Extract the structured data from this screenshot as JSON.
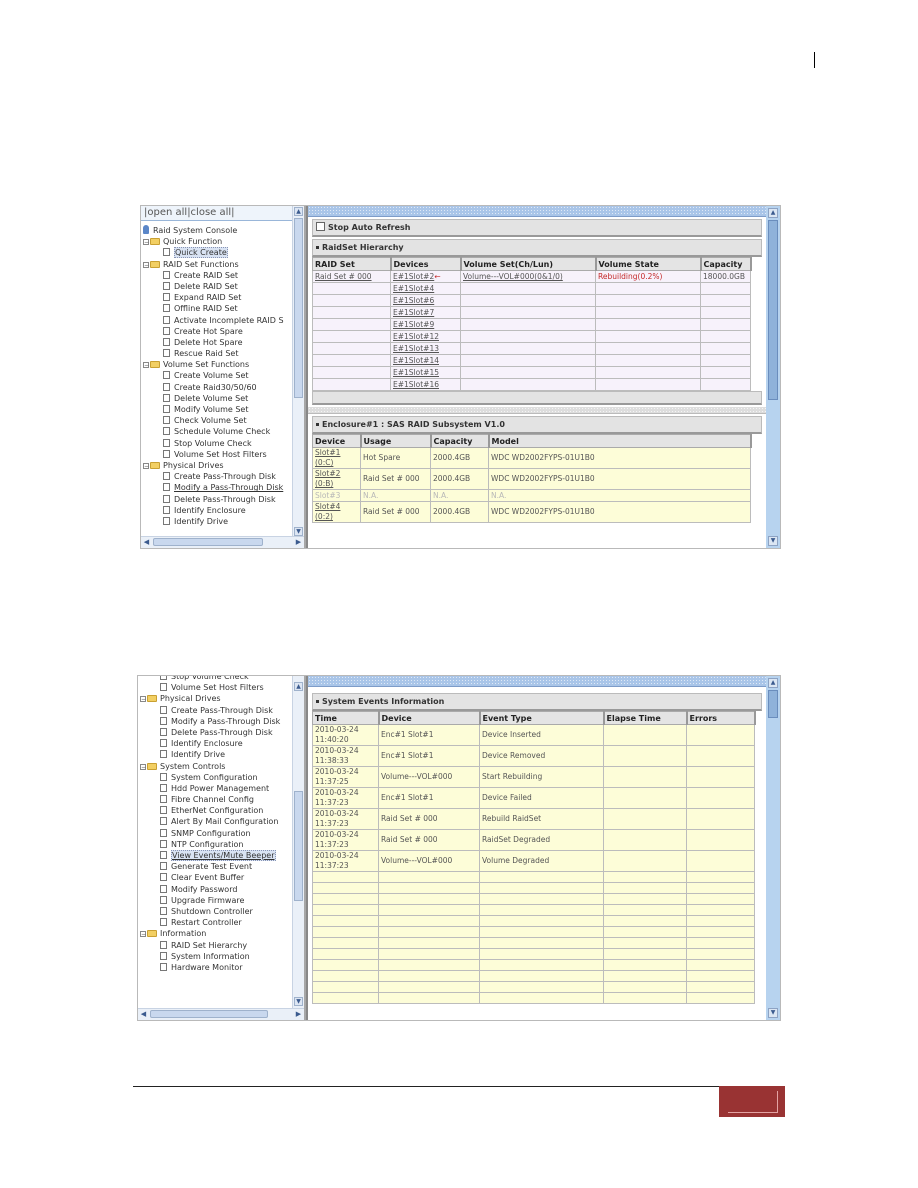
{
  "page": {
    "number": ""
  },
  "screenshot1": {
    "tree": {
      "header": "|open all|close all|",
      "items": [
        {
          "label": "Raid System Console",
          "level": 0,
          "type": "console"
        },
        {
          "label": "Quick Function",
          "level": 1,
          "type": "folder"
        },
        {
          "label": "Quick Create",
          "level": 2,
          "type": "page",
          "selected": true
        },
        {
          "label": "RAID Set Functions",
          "level": 1,
          "type": "folder"
        },
        {
          "label": "Create RAID Set",
          "level": 2,
          "type": "page"
        },
        {
          "label": "Delete RAID Set",
          "level": 2,
          "type": "page"
        },
        {
          "label": "Expand RAID Set",
          "level": 2,
          "type": "page"
        },
        {
          "label": "Offline RAID Set",
          "level": 2,
          "type": "page"
        },
        {
          "label": "Activate Incomplete RAID S",
          "level": 2,
          "type": "page"
        },
        {
          "label": "Create Hot Spare",
          "level": 2,
          "type": "page"
        },
        {
          "label": "Delete Hot Spare",
          "level": 2,
          "type": "page"
        },
        {
          "label": "Rescue Raid Set",
          "level": 2,
          "type": "page"
        },
        {
          "label": "Volume Set Functions",
          "level": 1,
          "type": "folder"
        },
        {
          "label": "Create Volume Set",
          "level": 2,
          "type": "page"
        },
        {
          "label": "Create Raid30/50/60",
          "level": 2,
          "type": "page"
        },
        {
          "label": "Delete Volume Set",
          "level": 2,
          "type": "page"
        },
        {
          "label": "Modify Volume Set",
          "level": 2,
          "type": "page"
        },
        {
          "label": "Check Volume Set",
          "level": 2,
          "type": "page"
        },
        {
          "label": "Schedule Volume Check",
          "level": 2,
          "type": "page"
        },
        {
          "label": "Stop Volume Check",
          "level": 2,
          "type": "page"
        },
        {
          "label": "Volume Set Host Filters",
          "level": 2,
          "type": "page"
        },
        {
          "label": "Physical Drives",
          "level": 1,
          "type": "folder"
        },
        {
          "label": "Create Pass-Through Disk",
          "level": 2,
          "type": "page"
        },
        {
          "label": "Modify a Pass-Through Disk",
          "level": 2,
          "type": "page",
          "hover": true
        },
        {
          "label": "Delete Pass-Through Disk",
          "level": 2,
          "type": "page"
        },
        {
          "label": "Identify Enclosure",
          "level": 2,
          "type": "page"
        },
        {
          "label": "Identify Drive",
          "level": 2,
          "type": "page"
        }
      ]
    },
    "stop_auto_refresh": "Stop Auto Refresh",
    "raidset_section": "RaidSet Hierarchy",
    "raidset_table": {
      "headers": [
        "RAID Set",
        "Devices",
        "Volume Set(Ch/Lun)",
        "Volume State",
        "Capacity"
      ],
      "raid_set": "Raid Set # 000",
      "devices": [
        "E#1Slot#2",
        "E#1Slot#4",
        "E#1Slot#6",
        "E#1Slot#7",
        "E#1Slot#9",
        "E#1Slot#12",
        "E#1Slot#13",
        "E#1Slot#14",
        "E#1Slot#15",
        "E#1Slot#16"
      ],
      "device_marker": "←",
      "volume_set": "Volume---VOL#000(0&1/0)",
      "volume_state": "Rebuilding(0.2%)",
      "capacity": "18000.0GB"
    },
    "enclosure_section": "Enclosure#1 : SAS RAID Subsystem V1.0",
    "enclosure_table": {
      "headers": [
        "Device",
        "Usage",
        "Capacity",
        "Model"
      ],
      "rows": [
        {
          "device": "Slot#1",
          "sub": "(0:C)",
          "usage": "Hot Spare",
          "capacity": "2000.4GB",
          "model": "WDC WD2002FYPS-01U1B0",
          "dim": false
        },
        {
          "device": "Slot#2",
          "sub": "(0:B)",
          "usage": "Raid Set # 000",
          "capacity": "2000.4GB",
          "model": "WDC WD2002FYPS-01U1B0",
          "dim": false
        },
        {
          "device": "Slot#3",
          "sub": "",
          "usage": "N.A.",
          "capacity": "N.A.",
          "model": "N.A.",
          "dim": true
        },
        {
          "device": "Slot#4",
          "sub": "(0:2)",
          "usage": "Raid Set # 000",
          "capacity": "2000.4GB",
          "model": "WDC WD2002FYPS-01U1B0",
          "dim": false
        }
      ]
    }
  },
  "screenshot2": {
    "tree": {
      "items": [
        {
          "label": "Stop Volume Check",
          "level": 2,
          "type": "page",
          "clipped": true
        },
        {
          "label": "Volume Set Host Filters",
          "level": 2,
          "type": "page"
        },
        {
          "label": "Physical Drives",
          "level": 1,
          "type": "folder"
        },
        {
          "label": "Create Pass-Through Disk",
          "level": 2,
          "type": "page"
        },
        {
          "label": "Modify a Pass-Through Disk",
          "level": 2,
          "type": "page"
        },
        {
          "label": "Delete Pass-Through Disk",
          "level": 2,
          "type": "page"
        },
        {
          "label": "Identify Enclosure",
          "level": 2,
          "type": "page"
        },
        {
          "label": "Identify Drive",
          "level": 2,
          "type": "page"
        },
        {
          "label": "System Controls",
          "level": 1,
          "type": "folder"
        },
        {
          "label": "System Configuration",
          "level": 2,
          "type": "page"
        },
        {
          "label": "Hdd Power Management",
          "level": 2,
          "type": "page"
        },
        {
          "label": "Fibre Channel Config",
          "level": 2,
          "type": "page"
        },
        {
          "label": "EtherNet Configuration",
          "level": 2,
          "type": "page"
        },
        {
          "label": "Alert By Mail Configuration",
          "level": 2,
          "type": "page"
        },
        {
          "label": "SNMP Configuration",
          "level": 2,
          "type": "page"
        },
        {
          "label": "NTP Configuration",
          "level": 2,
          "type": "page"
        },
        {
          "label": "View Events/Mute Beeper",
          "level": 2,
          "type": "page",
          "selected": true
        },
        {
          "label": "Generate Test Event",
          "level": 2,
          "type": "page"
        },
        {
          "label": "Clear Event Buffer",
          "level": 2,
          "type": "page"
        },
        {
          "label": "Modify Password",
          "level": 2,
          "type": "page"
        },
        {
          "label": "Upgrade Firmware",
          "level": 2,
          "type": "page"
        },
        {
          "label": "Shutdown Controller",
          "level": 2,
          "type": "page"
        },
        {
          "label": "Restart Controller",
          "level": 2,
          "type": "page"
        },
        {
          "label": "Information",
          "level": 1,
          "type": "folder"
        },
        {
          "label": "RAID Set Hierarchy",
          "level": 2,
          "type": "page"
        },
        {
          "label": "System Information",
          "level": 2,
          "type": "page"
        },
        {
          "label": "Hardware Monitor",
          "level": 2,
          "type": "page"
        }
      ]
    },
    "events_section": "System Events Information",
    "events_table": {
      "headers": [
        "Time",
        "Device",
        "Event Type",
        "Elapse Time",
        "Errors"
      ],
      "rows": [
        {
          "date": "2010-03-24",
          "time": "11:40:20",
          "device": "Enc#1 Slot#1",
          "event": "Device Inserted",
          "elapse": "",
          "errors": ""
        },
        {
          "date": "2010-03-24",
          "time": "11:38:33",
          "device": "Enc#1 Slot#1",
          "event": "Device Removed",
          "elapse": "",
          "errors": ""
        },
        {
          "date": "2010-03-24",
          "time": "11:37:25",
          "device": "Volume---VOL#000",
          "event": "Start Rebuilding",
          "elapse": "",
          "errors": ""
        },
        {
          "date": "2010-03-24",
          "time": "11:37:23",
          "device": "Enc#1 Slot#1",
          "event": "Device Failed",
          "elapse": "",
          "errors": ""
        },
        {
          "date": "2010-03-24",
          "time": "11:37:23",
          "device": "Raid Set # 000",
          "event": "Rebuild RaidSet",
          "elapse": "",
          "errors": ""
        },
        {
          "date": "2010-03-24",
          "time": "11:37:23",
          "device": "Raid Set # 000",
          "event": "RaidSet Degraded",
          "elapse": "",
          "errors": ""
        },
        {
          "date": "2010-03-24",
          "time": "11:37:23",
          "device": "Volume---VOL#000",
          "event": "Volume Degraded",
          "elapse": "",
          "errors": ""
        }
      ],
      "empty_rows": 12
    }
  }
}
